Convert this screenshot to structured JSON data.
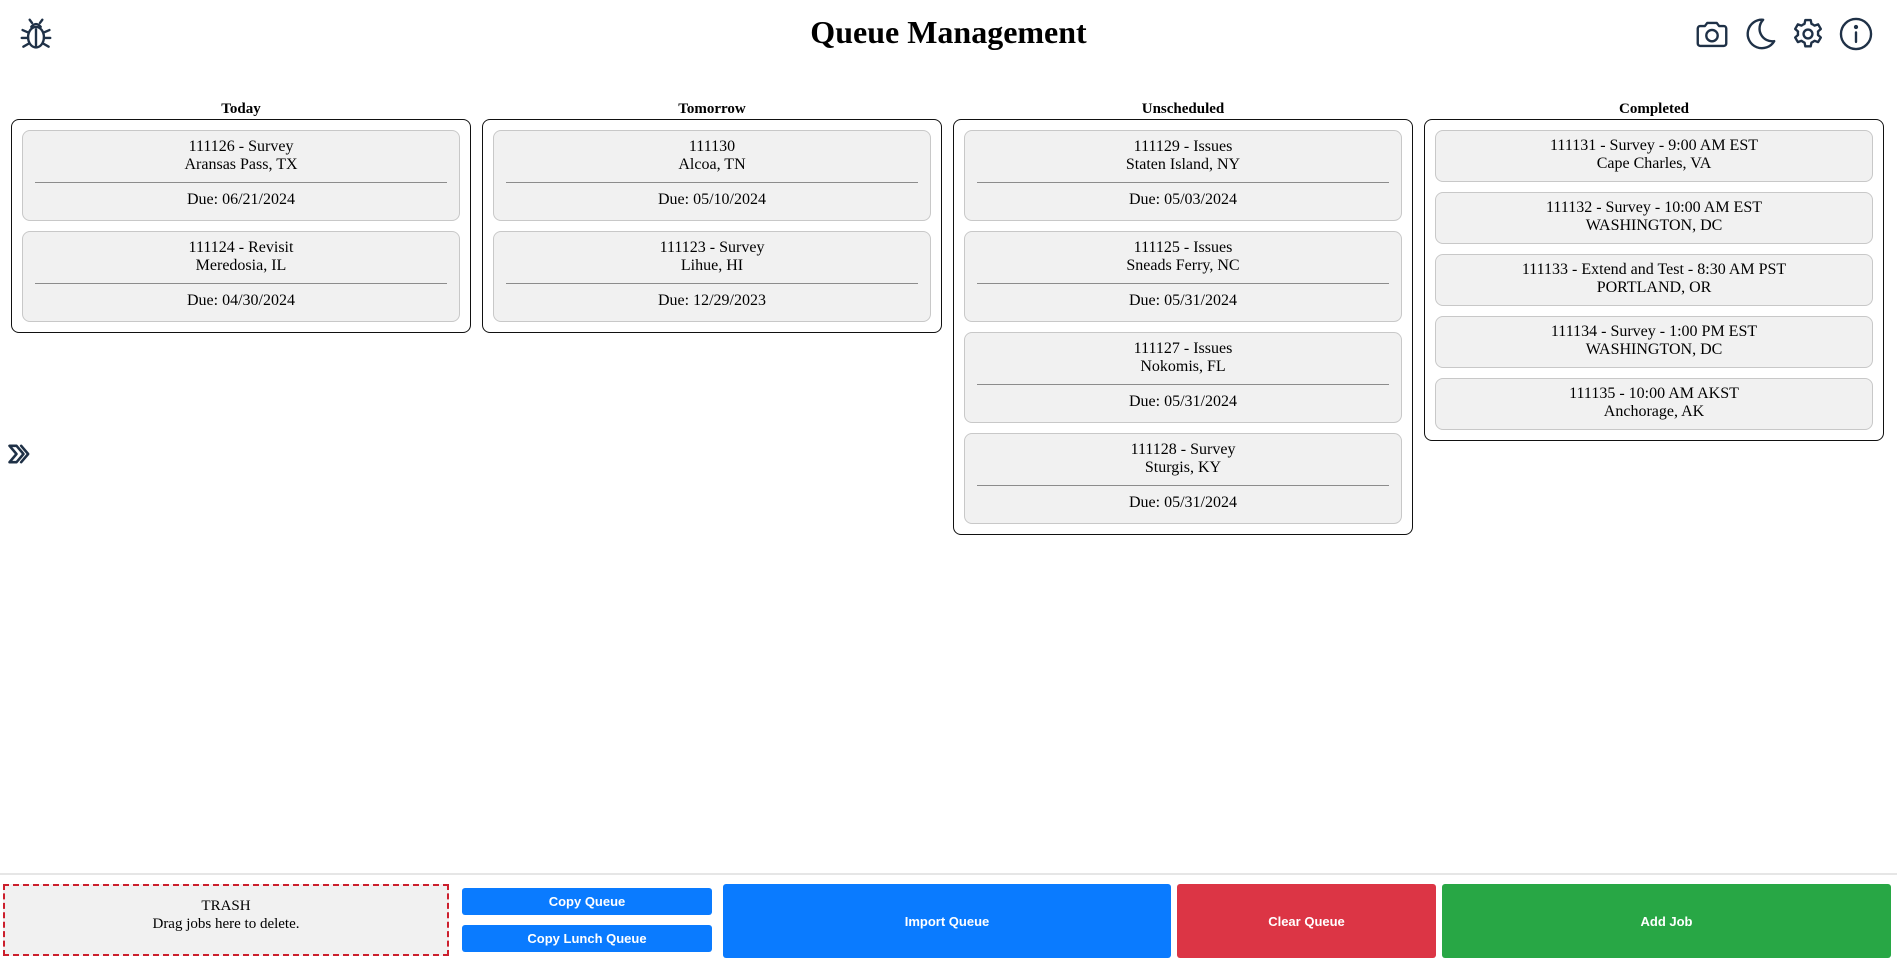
{
  "header": {
    "title": "Queue Management",
    "icons": [
      "bug-icon",
      "camera-icon",
      "moon-icon",
      "gear-icon",
      "info-icon"
    ]
  },
  "columns": [
    {
      "title": "Today",
      "cards": [
        {
          "line1": "111126 - Survey",
          "line2": "Aransas Pass, TX",
          "due": "Due: 06/21/2024"
        },
        {
          "line1": "111124 - Revisit",
          "line2": "Meredosia, IL",
          "due": "Due: 04/30/2024"
        }
      ]
    },
    {
      "title": "Tomorrow",
      "cards": [
        {
          "line1": "111130",
          "line2": "Alcoa, TN",
          "due": "Due: 05/10/2024"
        },
        {
          "line1": "111123 - Survey",
          "line2": "Lihue, HI",
          "due": "Due: 12/29/2023"
        }
      ]
    },
    {
      "title": "Unscheduled",
      "cards": [
        {
          "line1": "111129 - Issues",
          "line2": "Staten Island, NY",
          "due": "Due: 05/03/2024"
        },
        {
          "line1": "111125 - Issues",
          "line2": "Sneads Ferry, NC",
          "due": "Due: 05/31/2024"
        },
        {
          "line1": "111127 - Issues",
          "line2": "Nokomis, FL",
          "due": "Due: 05/31/2024"
        },
        {
          "line1": "111128 - Survey",
          "line2": "Sturgis, KY",
          "due": "Due: 05/31/2024"
        }
      ]
    },
    {
      "title": "Completed",
      "cards": [
        {
          "line1": "111131 - Survey - 9:00 AM EST",
          "line2": "Cape Charles, VA"
        },
        {
          "line1": "111132 - Survey - 10:00 AM EST",
          "line2": "WASHINGTON, DC"
        },
        {
          "line1": "111133 - Extend and Test - 8:30 AM PST",
          "line2": "PORTLAND, OR"
        },
        {
          "line1": "111134 - Survey - 1:00 PM EST",
          "line2": "WASHINGTON, DC"
        },
        {
          "line1": "111135 - 10:00 AM AKST",
          "line2": "Anchorage, AK"
        }
      ]
    }
  ],
  "footer": {
    "trash_title": "TRASH",
    "trash_hint": "Drag jobs here to delete.",
    "copy_queue": "Copy Queue",
    "copy_lunch_queue": "Copy Lunch Queue",
    "import_queue": "Import Queue",
    "clear_queue": "Clear Queue",
    "add_job": "Add Job"
  },
  "colors": {
    "primary": "#0a7bff",
    "danger": "#dc3545",
    "success": "#28a745",
    "icon": "#1f3147"
  }
}
